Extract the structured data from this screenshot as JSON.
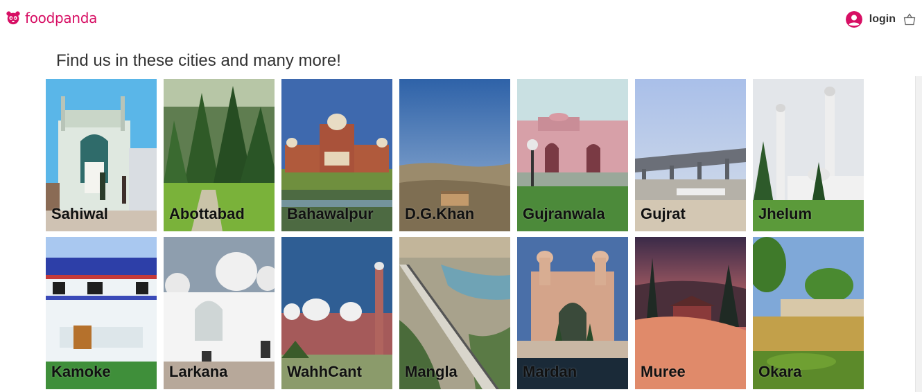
{
  "brand": {
    "name": "foodpanda",
    "color": "#d70f64"
  },
  "header": {
    "login_label": "login",
    "user_icon": "user-circle-icon",
    "cart_icon": "shopping-basket-icon"
  },
  "main": {
    "heading": "Find us in these cities and many more!"
  },
  "cities": [
    {
      "name": "Sahiwal"
    },
    {
      "name": "Abottabad"
    },
    {
      "name": "Bahawalpur"
    },
    {
      "name": "D.G.Khan"
    },
    {
      "name": "Gujranwala"
    },
    {
      "name": "Gujrat"
    },
    {
      "name": "Jhelum"
    },
    {
      "name": "Kamoke"
    },
    {
      "name": "Larkana"
    },
    {
      "name": "WahhCant"
    },
    {
      "name": "Mangla"
    },
    {
      "name": "Mardan"
    },
    {
      "name": "Muree"
    },
    {
      "name": "Okara"
    }
  ]
}
